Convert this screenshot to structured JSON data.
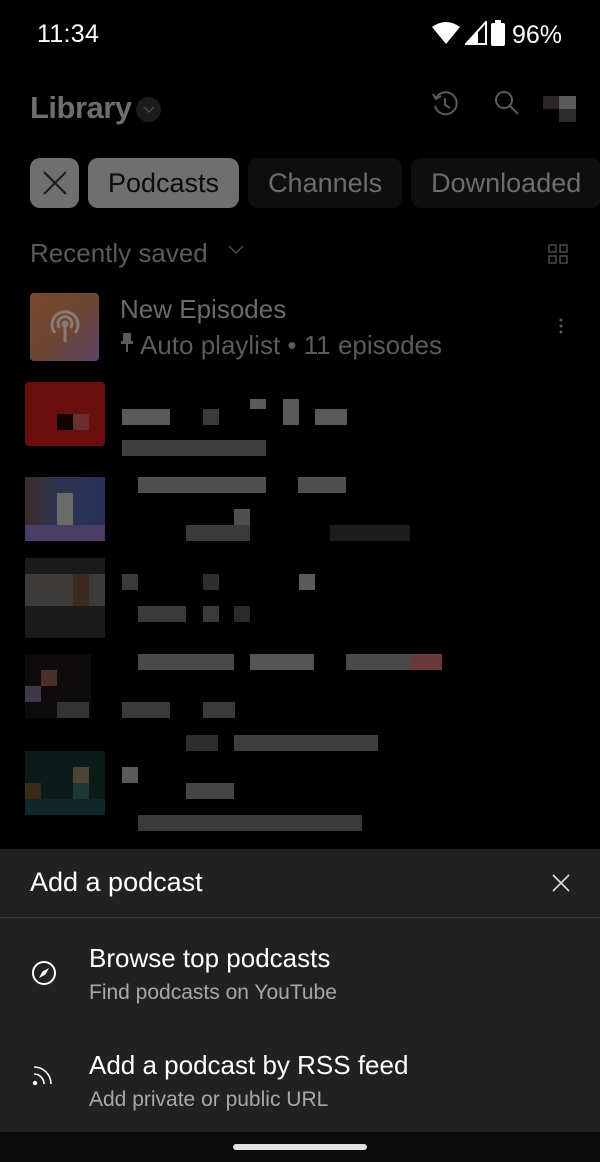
{
  "status_bar": {
    "time": "11:34",
    "battery_percent": "96%",
    "icons": [
      "wifi-icon",
      "cell-signal-icon",
      "battery-icon"
    ]
  },
  "header": {
    "title": "Library",
    "icons": [
      "history-icon",
      "search-icon",
      "account-avatar"
    ]
  },
  "chips": {
    "clear_icon": "close-icon",
    "items": [
      {
        "label": "Podcasts",
        "selected": true
      },
      {
        "label": "Channels",
        "selected": false
      },
      {
        "label": "Downloaded",
        "selected": false
      }
    ]
  },
  "sort": {
    "label": "Recently saved",
    "view_toggle_icon": "grid-view-icon"
  },
  "list": {
    "items": [
      {
        "title": "New Episodes",
        "pin_icon": "pin-icon",
        "subtitle": "Auto playlist • 11 episodes",
        "thumb_icon": "podcast-icon",
        "more_icon": "more-vert-icon"
      }
    ],
    "redacted_item_count": 5
  },
  "sheet": {
    "title": "Add a podcast",
    "close_icon": "close-icon",
    "options": [
      {
        "icon": "compass-icon",
        "title": "Browse top podcasts",
        "subtitle": "Find podcasts on YouTube"
      },
      {
        "icon": "rss-feed-icon",
        "title": "Add a podcast by RSS feed",
        "subtitle": "Add private or public URL"
      }
    ]
  },
  "colors": {
    "background": "#000000",
    "sheet_background": "#212121",
    "chip_selected": "#6f6f6f",
    "text_primary": "#ffffff",
    "text_secondary": "#a8a8a8"
  }
}
